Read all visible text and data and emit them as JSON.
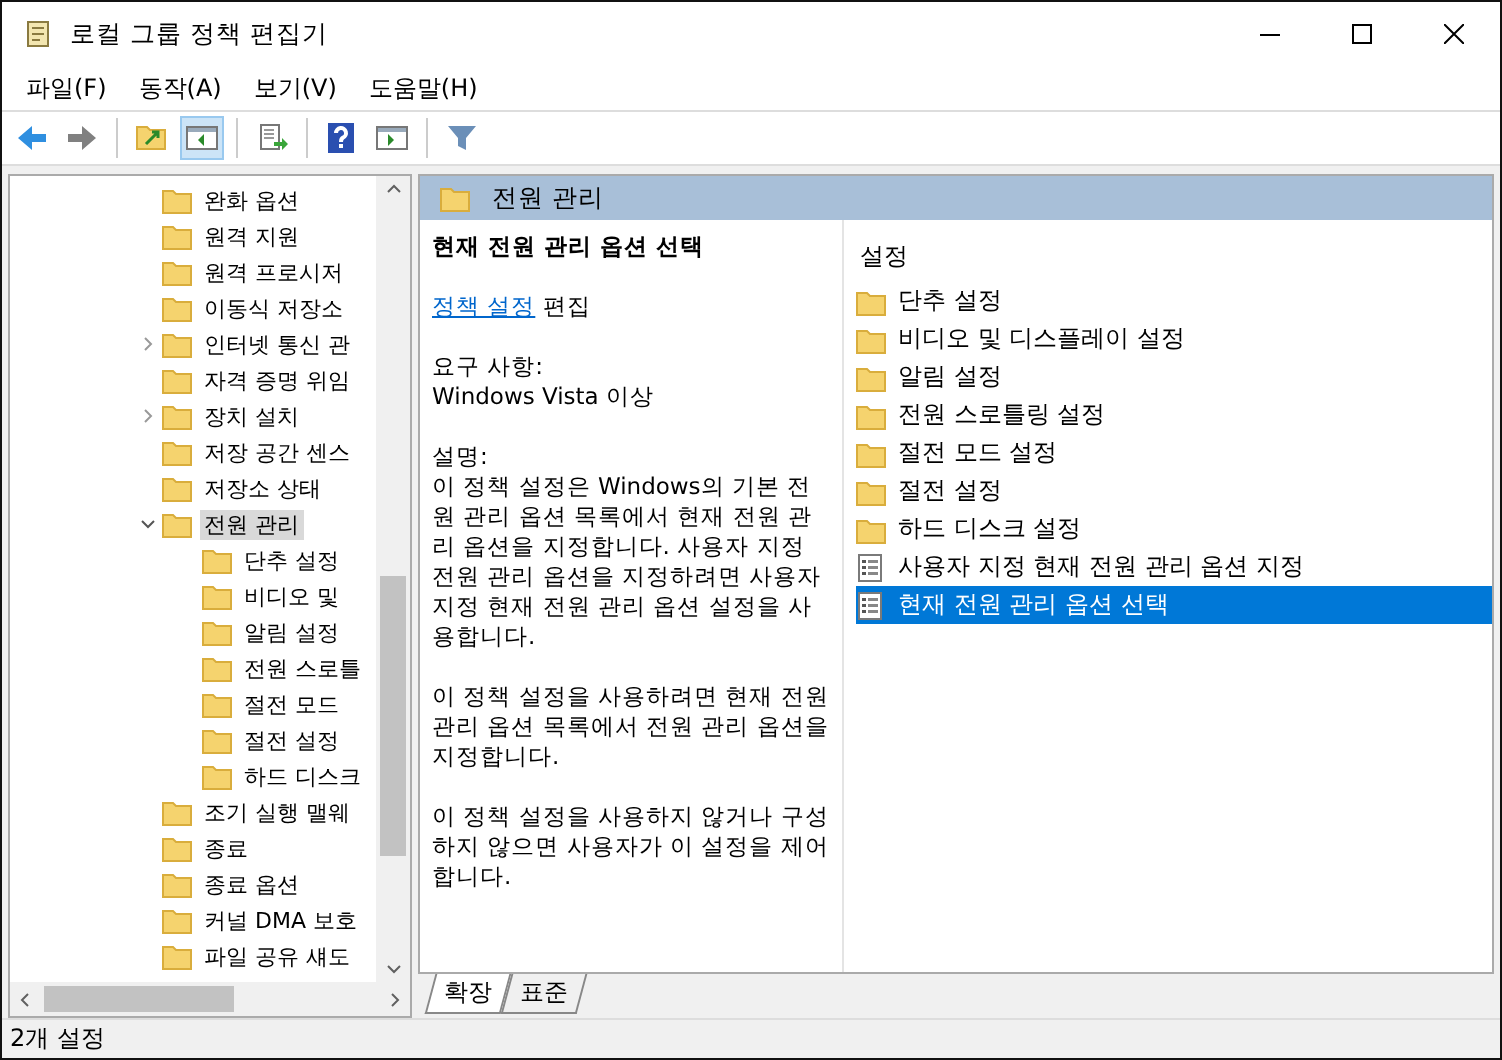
{
  "window": {
    "title": "로컬 그룹 정책 편집기"
  },
  "menu": [
    "파일(F)",
    "동작(A)",
    "보기(V)",
    "도움말(H)"
  ],
  "tree": [
    {
      "label": "완화 옵션",
      "expandable": false,
      "selected": false
    },
    {
      "label": "원격 지원",
      "expandable": false,
      "selected": false
    },
    {
      "label": "원격 프로시저",
      "expandable": false,
      "selected": false
    },
    {
      "label": "이동식 저장소",
      "expandable": false,
      "selected": false
    },
    {
      "label": "인터넷 통신 관",
      "expandable": true,
      "expanded": false,
      "selected": false
    },
    {
      "label": "자격 증명 위임",
      "expandable": false,
      "selected": false
    },
    {
      "label": "장치 설치",
      "expandable": true,
      "expanded": false,
      "selected": false
    },
    {
      "label": "저장 공간 센스",
      "expandable": false,
      "selected": false
    },
    {
      "label": "저장소 상태",
      "expandable": false,
      "selected": false
    },
    {
      "label": "전원 관리",
      "expandable": true,
      "expanded": true,
      "selected": true,
      "children": [
        {
          "label": "단추 설정",
          "expandable": false,
          "selected": false
        },
        {
          "label": "비디오 및",
          "expandable": false,
          "selected": false
        },
        {
          "label": "알림 설정",
          "expandable": false,
          "selected": false
        },
        {
          "label": "전원 스로틀",
          "expandable": false,
          "selected": false
        },
        {
          "label": "절전 모드",
          "expandable": false,
          "selected": false
        },
        {
          "label": "절전 설정",
          "expandable": false,
          "selected": false
        },
        {
          "label": "하드 디스크",
          "expandable": false,
          "selected": false
        }
      ]
    },
    {
      "label": "조기 실행 맬웨",
      "expandable": false,
      "selected": false
    },
    {
      "label": "종료",
      "expandable": false,
      "selected": false
    },
    {
      "label": "종료 옵션",
      "expandable": false,
      "selected": false
    },
    {
      "label": "커널 DMA 보호",
      "expandable": false,
      "selected": false
    },
    {
      "label": "파일 공유 섀도",
      "expandable": false,
      "selected": false
    }
  ],
  "header": {
    "title": "전원 관리"
  },
  "description": {
    "title": "현재 전원 관리 옵션 선택",
    "link": "정책 설정",
    "link_suffix": "편집",
    "requirements_label": "요구 사항:",
    "requirements": "Windows Vista 이상",
    "description_label": "설명:",
    "paragraphs": [
      "이 정책 설정은 Windows의 기본 전원 관리 옵션 목록에서 현재 전원 관리 옵션을 지정합니다. 사용자 지정 전원 관리 옵션을 지정하려면 사용자 지정 현재 전원 관리 옵션 설정을 사용합니다.",
      "이 정책 설정을 사용하려면 현재 전원 관리 옵션 목록에서 전원 관리 옵션을 지정합니다.",
      "이 정책 설정을 사용하지 않거나 구성하지 않으면 사용자가 이 설정을 제어합니다."
    ]
  },
  "list": {
    "column": "설정",
    "items": [
      {
        "kind": "folder",
        "label": "단추 설정",
        "selected": false
      },
      {
        "kind": "folder",
        "label": "비디오 및 디스플레이 설정",
        "selected": false
      },
      {
        "kind": "folder",
        "label": "알림 설정",
        "selected": false
      },
      {
        "kind": "folder",
        "label": "전원 스로틀링 설정",
        "selected": false
      },
      {
        "kind": "folder",
        "label": "절전 모드 설정",
        "selected": false
      },
      {
        "kind": "folder",
        "label": "절전 설정",
        "selected": false
      },
      {
        "kind": "folder",
        "label": "하드 디스크 설정",
        "selected": false
      },
      {
        "kind": "setting",
        "label": "사용자 지정 현재 전원 관리 옵션 지정",
        "selected": false
      },
      {
        "kind": "setting",
        "label": "현재 전원 관리 옵션 선택",
        "selected": true
      }
    ]
  },
  "view_tabs": [
    {
      "label": "확장",
      "selected": true
    },
    {
      "label": "표준",
      "selected": false
    }
  ],
  "status_bar": "2개 설정"
}
